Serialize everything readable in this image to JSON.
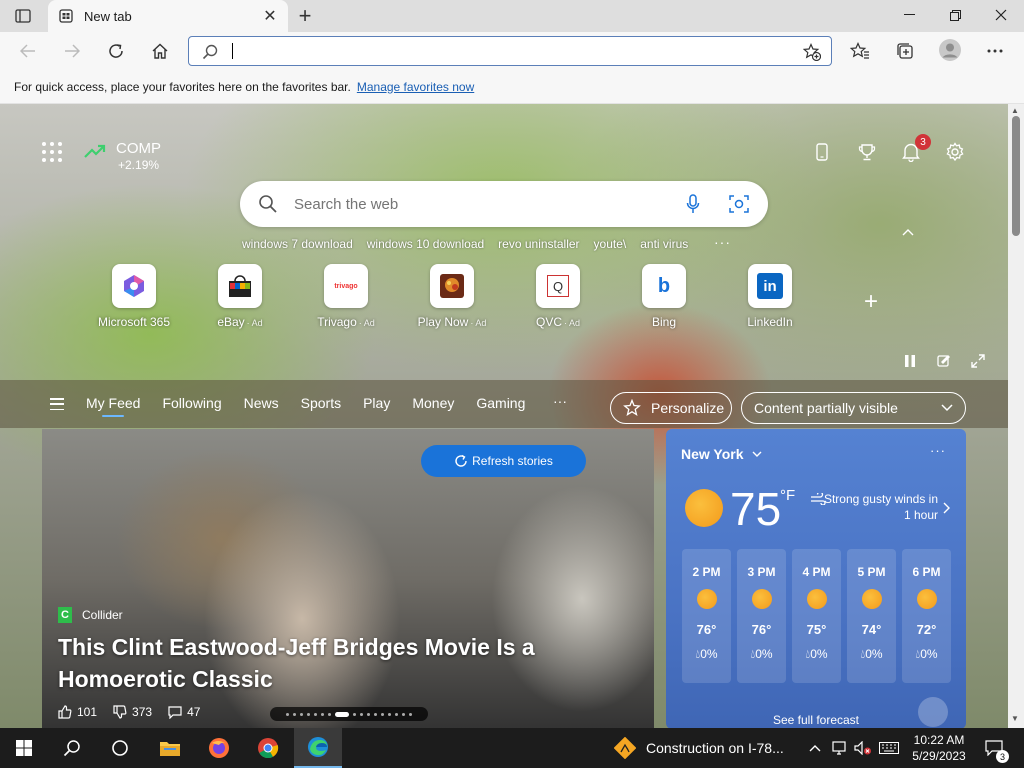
{
  "browser": {
    "tab_title": "New tab",
    "address_value": "",
    "favbar_message": "For quick access, place your favorites here on the favorites bar.",
    "favbar_link": "Manage favorites now"
  },
  "header": {
    "stock_symbol": "COMP",
    "stock_change": "+2.19%",
    "notification_count": "3"
  },
  "search": {
    "placeholder": "Search the web",
    "trending": [
      "windows 7 download",
      "windows 10 download",
      "revo uninstaller",
      "youte\\",
      "anti virus"
    ],
    "more": "···"
  },
  "quick_links": [
    {
      "label": "Microsoft 365",
      "ad": ""
    },
    {
      "label": "eBay",
      "ad": "· Ad"
    },
    {
      "label": "Trivago",
      "ad": "· Ad",
      "logo_text": "trivago"
    },
    {
      "label": "Play Now",
      "ad": "· Ad"
    },
    {
      "label": "QVC",
      "ad": "· Ad",
      "logo_text": "Q"
    },
    {
      "label": "Bing",
      "ad": "",
      "logo_text": "b"
    },
    {
      "label": "LinkedIn",
      "ad": "",
      "logo_text": "in"
    }
  ],
  "feed": {
    "tabs": [
      "My Feed",
      "Following",
      "News",
      "Sports",
      "Play",
      "Money",
      "Gaming"
    ],
    "more": "···",
    "personalize": "Personalize",
    "content_visibility": "Content partially visible",
    "refresh": "Refresh stories"
  },
  "hero": {
    "source": "Collider",
    "source_logo": "C",
    "title": "This Clint Eastwood-Jeff Bridges Movie Is a Homoerotic Classic",
    "likes": "101",
    "dislikes": "373",
    "comments": "47"
  },
  "weather": {
    "city": "New York",
    "temp": "75",
    "unit": "°F",
    "alert": "Strong gusty winds in 1 hour",
    "more": "···",
    "hours": [
      {
        "time": "2 PM",
        "temp": "76°",
        "precip": "0%"
      },
      {
        "time": "3 PM",
        "temp": "76°",
        "precip": "0%"
      },
      {
        "time": "4 PM",
        "temp": "75°",
        "precip": "0%"
      },
      {
        "time": "5 PM",
        "temp": "74°",
        "precip": "0%"
      },
      {
        "time": "6 PM",
        "temp": "72°",
        "precip": "0%"
      }
    ],
    "forecast_link": "See full forecast"
  },
  "taskbar": {
    "news_text": "Construction on I-78...",
    "time": "10:22 AM",
    "date": "5/29/2023",
    "notification_count": "3"
  },
  "colors": {
    "accent": "#1a73d9",
    "weather_bg": "#4a73c4",
    "badge": "#d13438"
  }
}
